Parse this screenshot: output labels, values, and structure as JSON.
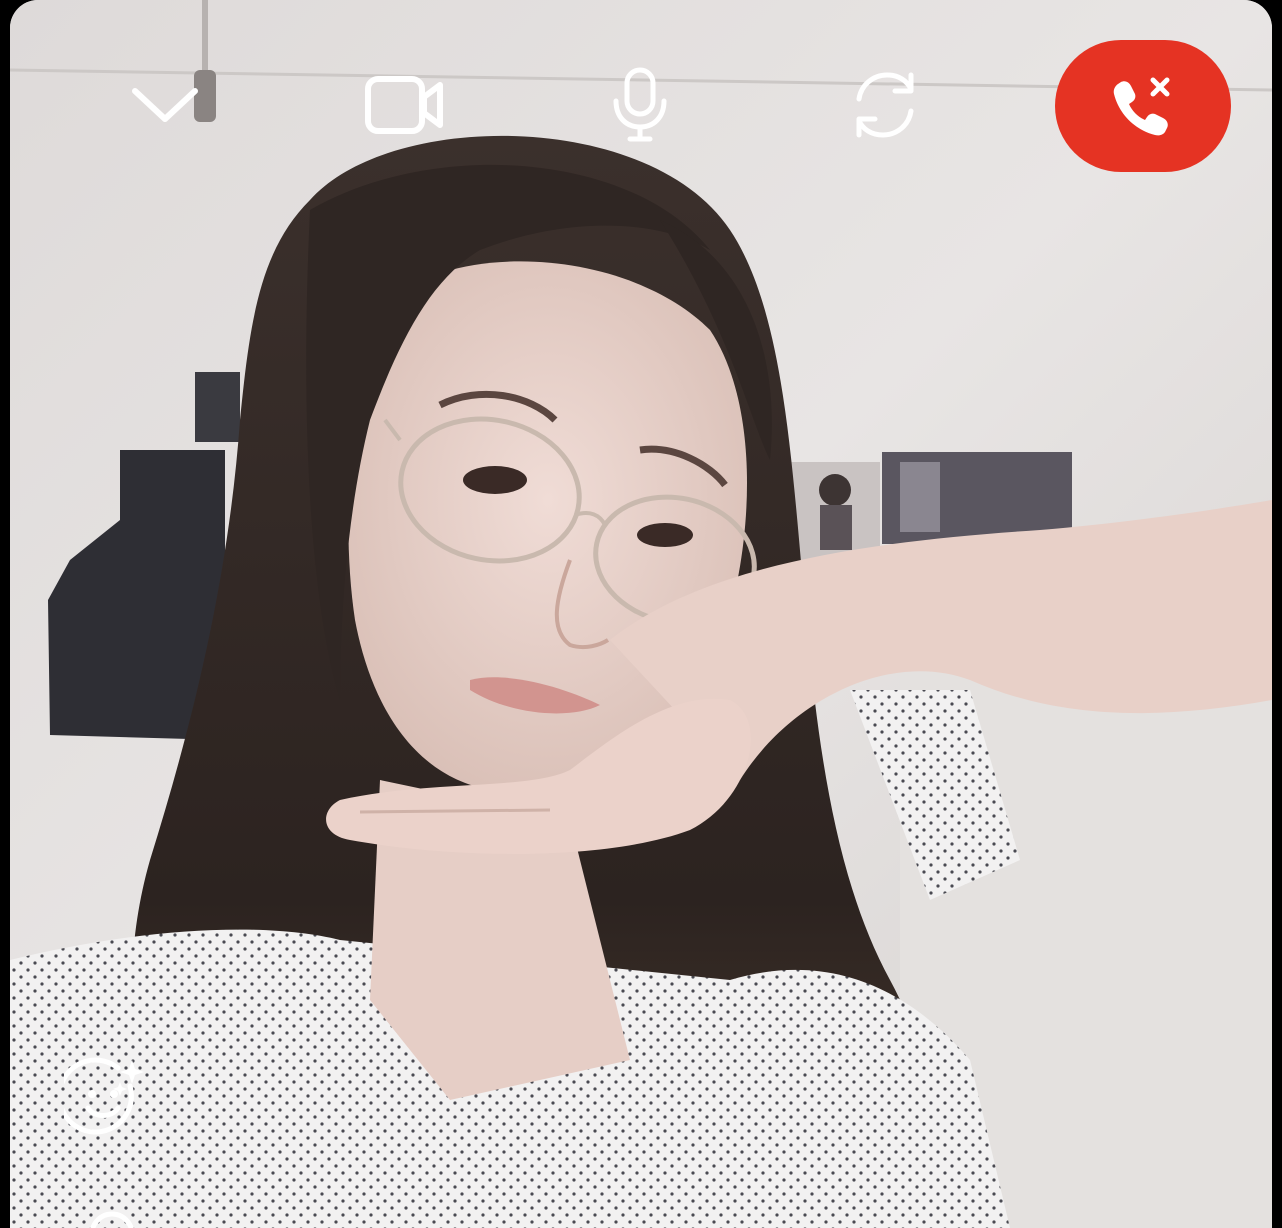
{
  "call": {
    "type": "video",
    "accent_colors": {
      "end_call": "#e53323",
      "icon": "#ffffff"
    }
  },
  "controls": {
    "top": [
      {
        "name": "collapse",
        "icon": "chevron-down-icon"
      },
      {
        "name": "video",
        "icon": "video-camera-icon"
      },
      {
        "name": "microphone",
        "icon": "microphone-icon"
      },
      {
        "name": "flip-camera",
        "icon": "flip-camera-icon"
      },
      {
        "name": "end-call",
        "icon": "phone-hangup-icon"
      }
    ],
    "side": [
      {
        "name": "effects",
        "icon": "sparkle-face-icon"
      },
      {
        "name": "more",
        "icon": "circle-icon"
      }
    ]
  }
}
